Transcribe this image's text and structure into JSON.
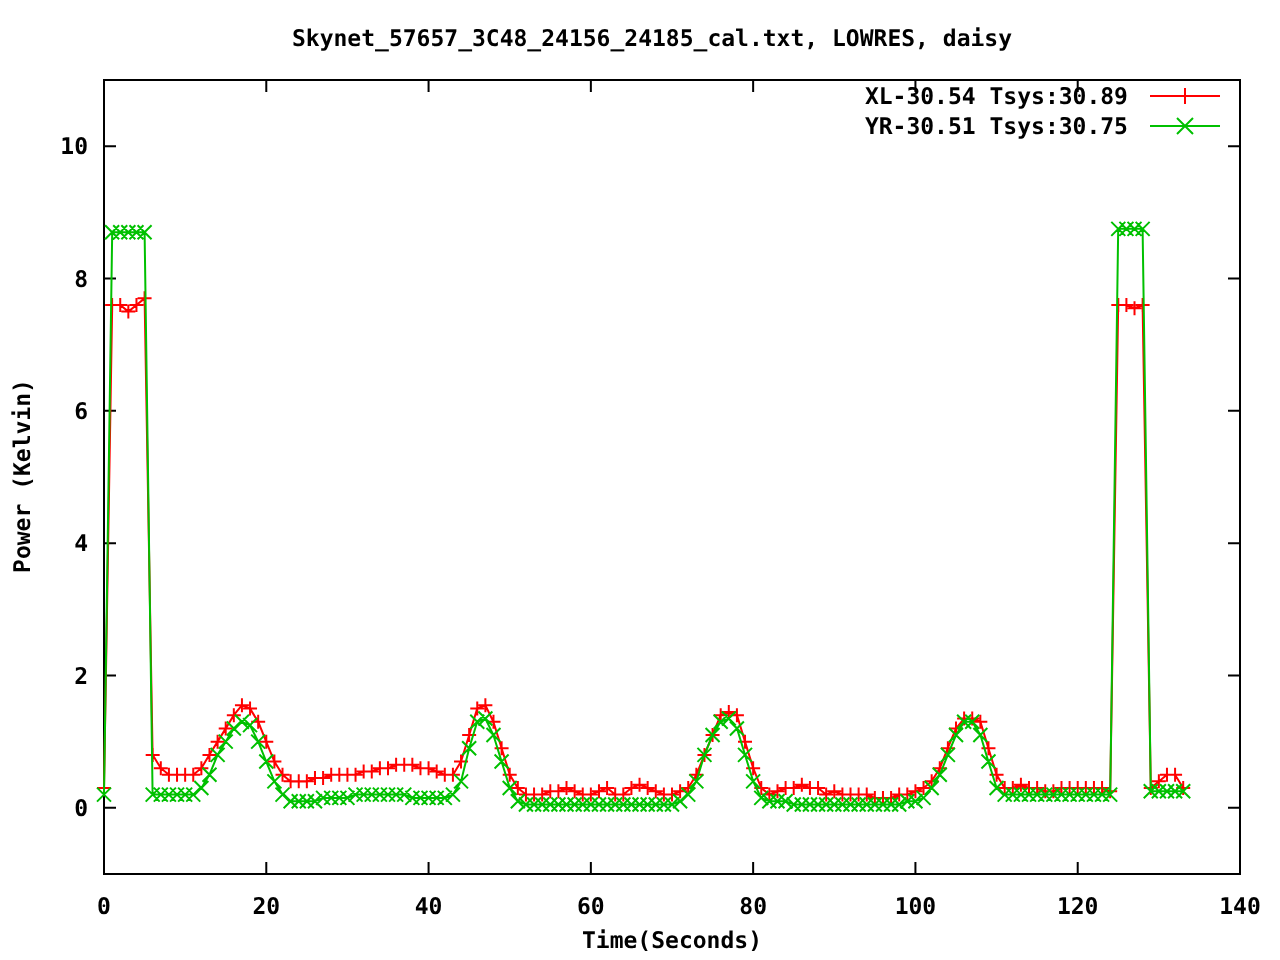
{
  "chart_data": {
    "type": "line",
    "title": "Skynet_57657_3C48_24156_24185_cal.txt, LOWRES, daisy",
    "xlabel": "Time(Seconds)",
    "ylabel": "Power (Kelvin)",
    "x": [
      0,
      1,
      2,
      3,
      4,
      5,
      6,
      7,
      8,
      9,
      10,
      11,
      12,
      13,
      14,
      15,
      16,
      17,
      18,
      19,
      20,
      21,
      22,
      23,
      24,
      25,
      26,
      27,
      28,
      29,
      30,
      31,
      32,
      33,
      34,
      35,
      36,
      37,
      38,
      39,
      40,
      41,
      42,
      43,
      44,
      45,
      46,
      47,
      48,
      49,
      50,
      51,
      52,
      53,
      54,
      55,
      56,
      57,
      58,
      59,
      60,
      61,
      62,
      63,
      64,
      65,
      66,
      67,
      68,
      69,
      70,
      71,
      72,
      73,
      74,
      75,
      76,
      77,
      78,
      79,
      80,
      81,
      82,
      83,
      84,
      85,
      86,
      87,
      88,
      89,
      90,
      91,
      92,
      93,
      94,
      95,
      96,
      97,
      98,
      99,
      100,
      101,
      102,
      103,
      104,
      105,
      106,
      107,
      108,
      109,
      110,
      111,
      112,
      113,
      114,
      115,
      116,
      117,
      118,
      119,
      120,
      121,
      122,
      123,
      124,
      125,
      126,
      127,
      128,
      129,
      130,
      131,
      132,
      133
    ],
    "series": [
      {
        "name": "XL-30.54 Tsys:30.89",
        "color": "#ff0000",
        "marker": "plus",
        "values": [
          0.3,
          7.6,
          7.6,
          7.5,
          7.6,
          7.7,
          0.8,
          0.6,
          0.5,
          0.5,
          0.5,
          0.5,
          0.6,
          0.8,
          1.0,
          1.2,
          1.4,
          1.55,
          1.5,
          1.3,
          1.0,
          0.7,
          0.5,
          0.4,
          0.4,
          0.4,
          0.45,
          0.45,
          0.5,
          0.5,
          0.5,
          0.5,
          0.55,
          0.55,
          0.6,
          0.6,
          0.65,
          0.65,
          0.65,
          0.6,
          0.6,
          0.55,
          0.5,
          0.5,
          0.7,
          1.1,
          1.5,
          1.55,
          1.3,
          0.9,
          0.5,
          0.3,
          0.2,
          0.2,
          0.2,
          0.25,
          0.25,
          0.3,
          0.25,
          0.2,
          0.2,
          0.25,
          0.3,
          0.2,
          0.2,
          0.3,
          0.35,
          0.3,
          0.25,
          0.2,
          0.2,
          0.25,
          0.3,
          0.5,
          0.8,
          1.1,
          1.4,
          1.45,
          1.4,
          1.0,
          0.6,
          0.3,
          0.2,
          0.25,
          0.3,
          0.3,
          0.35,
          0.3,
          0.3,
          0.2,
          0.25,
          0.2,
          0.2,
          0.2,
          0.2,
          0.15,
          0.15,
          0.15,
          0.2,
          0.2,
          0.25,
          0.3,
          0.4,
          0.6,
          0.9,
          1.2,
          1.35,
          1.35,
          1.3,
          0.9,
          0.5,
          0.3,
          0.3,
          0.35,
          0.3,
          0.3,
          0.25,
          0.25,
          0.3,
          0.3,
          0.3,
          0.3,
          0.3,
          0.3,
          0.25,
          7.6,
          7.6,
          7.55,
          7.6,
          0.3,
          0.4,
          0.5,
          0.5,
          0.3
        ]
      },
      {
        "name": "YR-30.51 Tsys:30.75",
        "color": "#00c000",
        "marker": "cross",
        "values": [
          0.2,
          8.7,
          8.7,
          8.7,
          8.7,
          8.7,
          0.2,
          0.2,
          0.2,
          0.2,
          0.2,
          0.2,
          0.3,
          0.5,
          0.8,
          1.0,
          1.2,
          1.3,
          1.25,
          1.0,
          0.7,
          0.4,
          0.2,
          0.1,
          0.1,
          0.1,
          0.1,
          0.15,
          0.15,
          0.15,
          0.15,
          0.2,
          0.2,
          0.2,
          0.2,
          0.2,
          0.2,
          0.2,
          0.15,
          0.15,
          0.15,
          0.15,
          0.15,
          0.2,
          0.4,
          0.9,
          1.3,
          1.35,
          1.1,
          0.7,
          0.3,
          0.1,
          0.05,
          0.05,
          0.05,
          0.05,
          0.05,
          0.05,
          0.05,
          0.05,
          0.05,
          0.05,
          0.05,
          0.05,
          0.05,
          0.05,
          0.05,
          0.05,
          0.05,
          0.05,
          0.05,
          0.1,
          0.2,
          0.4,
          0.8,
          1.1,
          1.3,
          1.35,
          1.2,
          0.8,
          0.4,
          0.15,
          0.1,
          0.1,
          0.1,
          0.05,
          0.05,
          0.05,
          0.05,
          0.05,
          0.05,
          0.05,
          0.05,
          0.05,
          0.05,
          0.05,
          0.05,
          0.05,
          0.05,
          0.1,
          0.1,
          0.15,
          0.3,
          0.5,
          0.8,
          1.1,
          1.3,
          1.3,
          1.1,
          0.7,
          0.3,
          0.2,
          0.2,
          0.2,
          0.2,
          0.2,
          0.2,
          0.2,
          0.2,
          0.2,
          0.2,
          0.2,
          0.2,
          0.2,
          0.2,
          8.75,
          8.75,
          8.75,
          8.75,
          0.25,
          0.25,
          0.25,
          0.25,
          0.25
        ]
      }
    ],
    "legend": true,
    "xlim": [
      0,
      140
    ],
    "ylim": [
      -1,
      11
    ],
    "xticks": [
      0,
      20,
      40,
      60,
      80,
      100,
      120,
      140
    ],
    "yticks": [
      0,
      2,
      4,
      6,
      8,
      10
    ]
  }
}
